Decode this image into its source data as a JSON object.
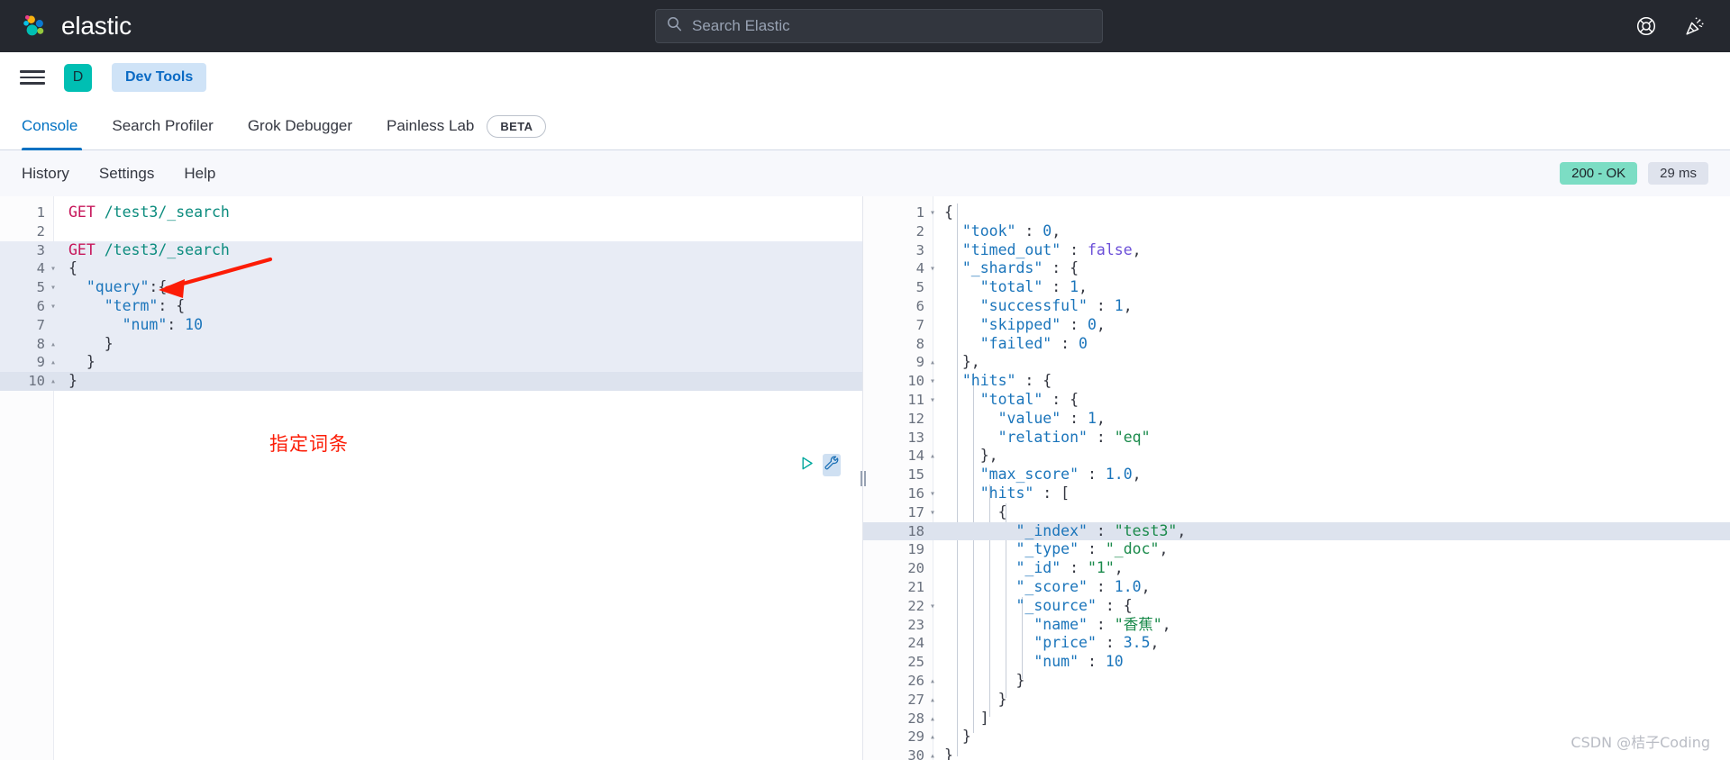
{
  "header": {
    "brand_name": "elastic",
    "logo_icon": "elastic-logo-icon",
    "search_placeholder": "Search Elastic",
    "search_icon": "search-icon",
    "help_icon": "help-lifebuoy-icon",
    "whats_new_icon": "party-popper-icon"
  },
  "nav": {
    "menu_icon": "hamburger-menu-icon",
    "space_initial": "D",
    "breadcrumb": "Dev Tools"
  },
  "tabs": [
    {
      "label": "Console",
      "active": true,
      "badge": null
    },
    {
      "label": "Search Profiler",
      "active": false,
      "badge": null
    },
    {
      "label": "Grok Debugger",
      "active": false,
      "badge": null
    },
    {
      "label": "Painless Lab",
      "active": false,
      "badge": "BETA"
    }
  ],
  "console_menu": {
    "items": [
      "History",
      "Settings",
      "Help"
    ],
    "status_code": "200 - OK",
    "status_time": "29 ms",
    "status_ok_color": "#7cddc4"
  },
  "editor": {
    "play_icon": "play-triangle-icon",
    "wrench_icon": "wrench-icon",
    "splitter_icon": "vertical-drag-handle-icon",
    "lines": [
      {
        "n": "1",
        "fold": "",
        "html": "<span class='k-method'>GET</span> <span class='k-url'>/test3/_search</span>",
        "hl": ""
      },
      {
        "n": "2",
        "fold": "",
        "html": "",
        "hl": ""
      },
      {
        "n": "3",
        "fold": "",
        "html": "<span class='k-method'>GET</span> <span class='k-url'>/test3/_search</span>",
        "hl": "req"
      },
      {
        "n": "4",
        "fold": "▾",
        "html": "<span class='k-plain'>{</span>",
        "hl": "req"
      },
      {
        "n": "5",
        "fold": "▾",
        "html": "  <span class='k-key'>\"query\"</span><span class='k-plain'>:{</span>",
        "hl": "req"
      },
      {
        "n": "6",
        "fold": "▾",
        "html": "    <span class='k-key'>\"term\"</span><span class='k-plain'>: {</span>",
        "hl": "req"
      },
      {
        "n": "7",
        "fold": "",
        "html": "      <span class='k-key'>\"num\"</span><span class='k-plain'>: </span><span class='k-num'>10</span>",
        "hl": "req"
      },
      {
        "n": "8",
        "fold": "▴",
        "html": "    <span class='k-plain'>}</span>",
        "hl": "req"
      },
      {
        "n": "9",
        "fold": "▴",
        "html": "  <span class='k-plain'>}</span>",
        "hl": "req"
      },
      {
        "n": "10",
        "fold": "▴",
        "html": "<span class='k-plain'>}</span>",
        "hl": "cursor"
      }
    ],
    "annotation": "指定词条",
    "annotation_color": "#fc1c06",
    "annotation_arrow_icon": "red-arrow-icon"
  },
  "response": {
    "lines": [
      {
        "n": "1",
        "fold": "▾",
        "html": "<span class='k-plain'>{</span>",
        "hl": ""
      },
      {
        "n": "2",
        "fold": "",
        "html": "  <span class='k-key'>\"took\"</span> <span class='k-plain'>:</span> <span class='k-num'>0</span><span class='k-plain'>,</span>",
        "hl": ""
      },
      {
        "n": "3",
        "fold": "",
        "html": "  <span class='k-key'>\"timed_out\"</span> <span class='k-plain'>:</span> <span class='k-bool'>false</span><span class='k-plain'>,</span>",
        "hl": ""
      },
      {
        "n": "4",
        "fold": "▾",
        "html": "  <span class='k-key'>\"_shards\"</span> <span class='k-plain'>: {</span>",
        "hl": ""
      },
      {
        "n": "5",
        "fold": "",
        "html": "    <span class='k-key'>\"total\"</span> <span class='k-plain'>:</span> <span class='k-num'>1</span><span class='k-plain'>,</span>",
        "hl": ""
      },
      {
        "n": "6",
        "fold": "",
        "html": "    <span class='k-key'>\"successful\"</span> <span class='k-plain'>:</span> <span class='k-num'>1</span><span class='k-plain'>,</span>",
        "hl": ""
      },
      {
        "n": "7",
        "fold": "",
        "html": "    <span class='k-key'>\"skipped\"</span> <span class='k-plain'>:</span> <span class='k-num'>0</span><span class='k-plain'>,</span>",
        "hl": ""
      },
      {
        "n": "8",
        "fold": "",
        "html": "    <span class='k-key'>\"failed\"</span> <span class='k-plain'>:</span> <span class='k-num'>0</span>",
        "hl": ""
      },
      {
        "n": "9",
        "fold": "▴",
        "html": "  <span class='k-plain'>},</span>",
        "hl": ""
      },
      {
        "n": "10",
        "fold": "▾",
        "html": "  <span class='k-key'>\"hits\"</span> <span class='k-plain'>: {</span>",
        "hl": ""
      },
      {
        "n": "11",
        "fold": "▾",
        "html": "    <span class='k-key'>\"total\"</span> <span class='k-plain'>: {</span>",
        "hl": ""
      },
      {
        "n": "12",
        "fold": "",
        "html": "      <span class='k-key'>\"value\"</span> <span class='k-plain'>:</span> <span class='k-num'>1</span><span class='k-plain'>,</span>",
        "hl": ""
      },
      {
        "n": "13",
        "fold": "",
        "html": "      <span class='k-key'>\"relation\"</span> <span class='k-plain'>:</span> <span class='k-str'>\"eq\"</span>",
        "hl": ""
      },
      {
        "n": "14",
        "fold": "▴",
        "html": "    <span class='k-plain'>},</span>",
        "hl": ""
      },
      {
        "n": "15",
        "fold": "",
        "html": "    <span class='k-key'>\"max_score\"</span> <span class='k-plain'>:</span> <span class='k-num'>1.0</span><span class='k-plain'>,</span>",
        "hl": ""
      },
      {
        "n": "16",
        "fold": "▾",
        "html": "    <span class='k-key'>\"hits\"</span> <span class='k-plain'>: [</span>",
        "hl": ""
      },
      {
        "n": "17",
        "fold": "▾",
        "html": "      <span class='k-plain'>{</span>",
        "hl": ""
      },
      {
        "n": "18",
        "fold": "",
        "html": "        <span class='k-key'>\"_index\"</span> <span class='k-plain'>:</span> <span class='k-str'>\"test3\"</span><span class='k-plain'>,</span>",
        "hl": "cursor"
      },
      {
        "n": "19",
        "fold": "",
        "html": "        <span class='k-key'>\"_type\"</span> <span class='k-plain'>:</span> <span class='k-str'>\"_doc\"</span><span class='k-plain'>,</span>",
        "hl": ""
      },
      {
        "n": "20",
        "fold": "",
        "html": "        <span class='k-key'>\"_id\"</span> <span class='k-plain'>:</span> <span class='k-str'>\"1\"</span><span class='k-plain'>,</span>",
        "hl": ""
      },
      {
        "n": "21",
        "fold": "",
        "html": "        <span class='k-key'>\"_score\"</span> <span class='k-plain'>:</span> <span class='k-num'>1.0</span><span class='k-plain'>,</span>",
        "hl": ""
      },
      {
        "n": "22",
        "fold": "▾",
        "html": "        <span class='k-key'>\"_source\"</span> <span class='k-plain'>: {</span>",
        "hl": ""
      },
      {
        "n": "23",
        "fold": "",
        "html": "          <span class='k-key'>\"name\"</span> <span class='k-plain'>:</span> <span class='k-str'>\"香蕉\"</span><span class='k-plain'>,</span>",
        "hl": ""
      },
      {
        "n": "24",
        "fold": "",
        "html": "          <span class='k-key'>\"price\"</span> <span class='k-plain'>:</span> <span class='k-num'>3.5</span><span class='k-plain'>,</span>",
        "hl": ""
      },
      {
        "n": "25",
        "fold": "",
        "html": "          <span class='k-key'>\"num\"</span> <span class='k-plain'>:</span> <span class='k-num'>10</span>",
        "hl": ""
      },
      {
        "n": "26",
        "fold": "▴",
        "html": "        <span class='k-plain'>}</span>",
        "hl": ""
      },
      {
        "n": "27",
        "fold": "▴",
        "html": "      <span class='k-plain'>}</span>",
        "hl": ""
      },
      {
        "n": "28",
        "fold": "▴",
        "html": "    <span class='k-plain'>]</span>",
        "hl": ""
      },
      {
        "n": "29",
        "fold": "▴",
        "html": "  <span class='k-plain'>}</span>",
        "hl": ""
      },
      {
        "n": "30",
        "fold": "▴",
        "html": "<span class='k-plain'>}</span>",
        "hl": ""
      }
    ]
  },
  "watermark": "CSDN @桔子Coding"
}
